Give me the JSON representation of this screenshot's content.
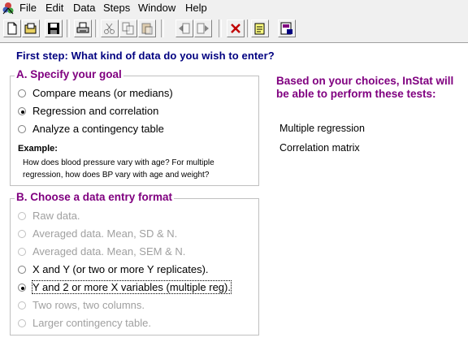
{
  "menubar": {
    "items": [
      "File",
      "Edit",
      "Data",
      "Steps",
      "Window",
      "Help"
    ]
  },
  "toolbar": {
    "buttons": [
      {
        "icon": "new-file-icon"
      },
      {
        "icon": "open-folder-icon"
      },
      {
        "icon": "save-icon"
      },
      {
        "icon": "print-icon"
      },
      {
        "icon": "cut-icon"
      },
      {
        "icon": "copy-icon"
      },
      {
        "icon": "paste-icon"
      },
      {
        "icon": "back-step-icon"
      },
      {
        "icon": "next-step-icon"
      },
      {
        "icon": "close-icon"
      },
      {
        "icon": "notes-icon"
      },
      {
        "icon": "report-icon"
      }
    ]
  },
  "step_heading": "First step: What kind of data do you wish to enter?",
  "goal": {
    "legend": "A. Specify your goal",
    "options": [
      {
        "label": "Compare means (or medians)",
        "checked": false
      },
      {
        "label": "Regression and correlation",
        "checked": true
      },
      {
        "label": "Analyze a contingency table",
        "checked": false
      }
    ],
    "example_title": "Example:",
    "example_text": "How does blood pressure vary with age? For multiple regression, how does BP vary with age and weight?"
  },
  "format": {
    "legend": "B. Choose a data entry format",
    "options": [
      {
        "label": "Raw data.",
        "enabled": false,
        "checked": false
      },
      {
        "label": "Averaged data. Mean, SD & N.",
        "enabled": false,
        "checked": false
      },
      {
        "label": "Averaged data. Mean, SEM & N.",
        "enabled": false,
        "checked": false
      },
      {
        "label": "X and Y (or two or more Y replicates).",
        "enabled": true,
        "checked": false
      },
      {
        "label": "Y and 2 or more X variables (multiple reg).",
        "enabled": true,
        "checked": true
      },
      {
        "label": "Two rows, two columns.",
        "enabled": false,
        "checked": false
      },
      {
        "label": "Larger contingency table.",
        "enabled": false,
        "checked": false
      }
    ]
  },
  "tests": {
    "heading": "Based on your choices, InStat will be able to perform these tests:",
    "items": [
      "Multiple regression",
      "Correlation matrix"
    ]
  },
  "colors": {
    "heading_blue": "#000080",
    "group_purple": "#800080",
    "disabled_text": "#a0a0a0"
  }
}
